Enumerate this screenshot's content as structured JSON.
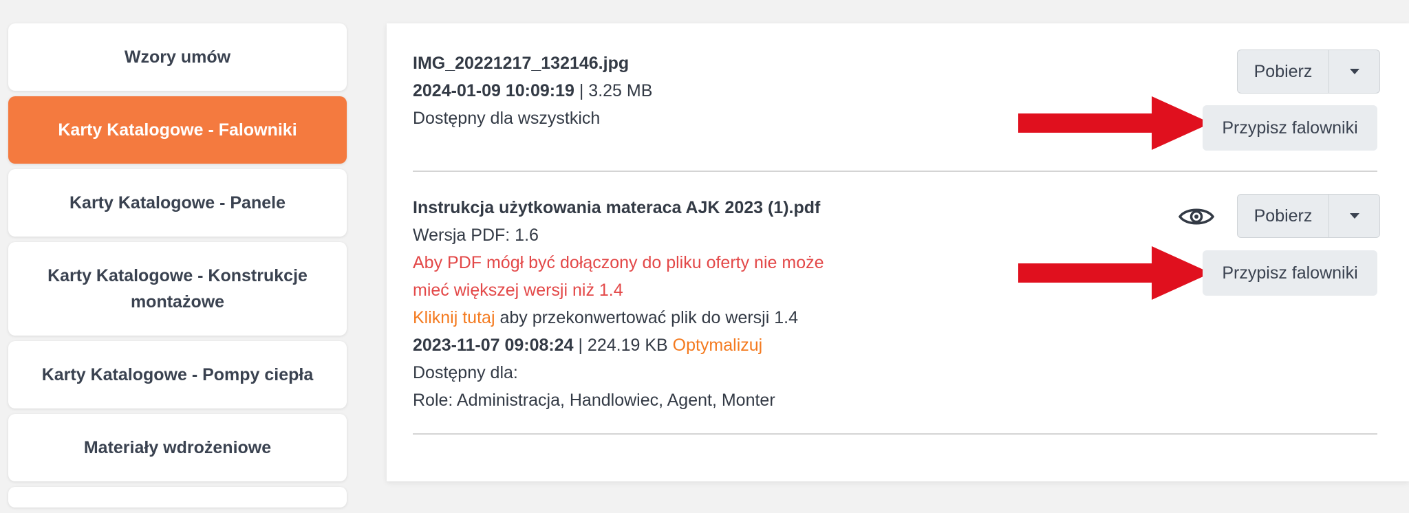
{
  "sidebar": {
    "items": [
      {
        "label": "Wzory umów"
      },
      {
        "label": "Karty Katalogowe - Falowniki"
      },
      {
        "label": "Karty Katalogowe - Panele"
      },
      {
        "label": "Karty Katalogowe - Konstrukcje montażowe"
      },
      {
        "label": "Karty Katalogowe - Pompy ciepła"
      },
      {
        "label": "Materiały wdrożeniowe"
      }
    ]
  },
  "files": [
    {
      "name": "IMG_20221217_132146.jpg",
      "date": "2024-01-09 10:09:19",
      "size": " | 3.25 MB",
      "availability": "Dostępny dla wszystkich",
      "download_label": "Pobierz",
      "assign_label": "Przypisz falowniki"
    },
    {
      "name": "Instrukcja użytkowania materaca AJK 2023 (1).pdf",
      "pdf_version": "Wersja PDF: 1.6",
      "warning_line1": "Aby PDF mógł być dołączony do pliku oferty nie może",
      "warning_line2": "mieć większej wersji niż 1.4",
      "convert_link": "Kliknij tutaj",
      "convert_text": " aby przekonwertować plik do wersji 1.4",
      "date": "2023-11-07 09:08:24",
      "size": " | 224.19 KB ",
      "optimize_link": "Optymalizuj",
      "availability": "Dostępny dla:",
      "roles": "Role: Administracja, Handlowiec, Agent, Monter",
      "download_label": "Pobierz",
      "assign_label": "Przypisz falowniki"
    }
  ],
  "icons": {
    "eye": "eye-icon",
    "caret": "caret-down-icon",
    "arrow": "arrow-right-icon"
  },
  "colors": {
    "accent": "#f47a3f",
    "warning": "#e34848",
    "link": "#f47a1f",
    "annotation_arrow": "#e0101e"
  }
}
